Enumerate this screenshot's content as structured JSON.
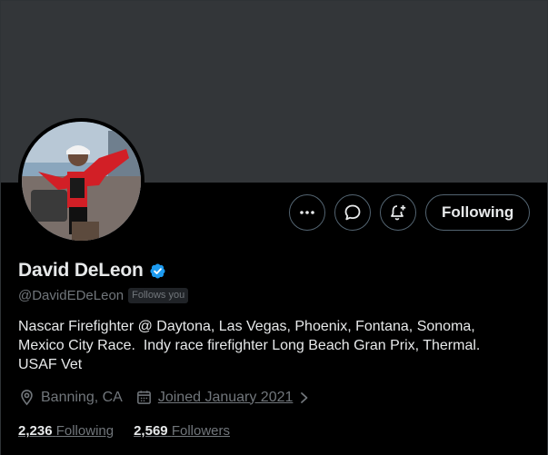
{
  "profile": {
    "name": "David DeLeon",
    "handle": "@DavidEDeLeon",
    "follows_you": "Follows you",
    "bio_lines": [
      "Nascar Firefighter @ Daytona, Las Vegas, Phoenix, Fontana, Sonoma,",
      "Mexico City Race.  Indy race firefighter Long Beach Gran Prix, Thermal.",
      "USAF Vet"
    ],
    "location": "Banning, CA",
    "joined": "Joined January 2021",
    "following_count": "2,236",
    "following_label": "Following",
    "followers_count": "2,569",
    "followers_label": "Followers"
  },
  "actions": {
    "more_icon": "more-icon",
    "message_icon": "message-icon",
    "notify_icon": "notification-bell-plus-icon",
    "follow_state": "Following"
  },
  "colors": {
    "background": "#000000",
    "banner": "#333639",
    "verified": "#1d9bf0",
    "muted_text": "#71767b",
    "primary_text": "#e7e9ea"
  }
}
